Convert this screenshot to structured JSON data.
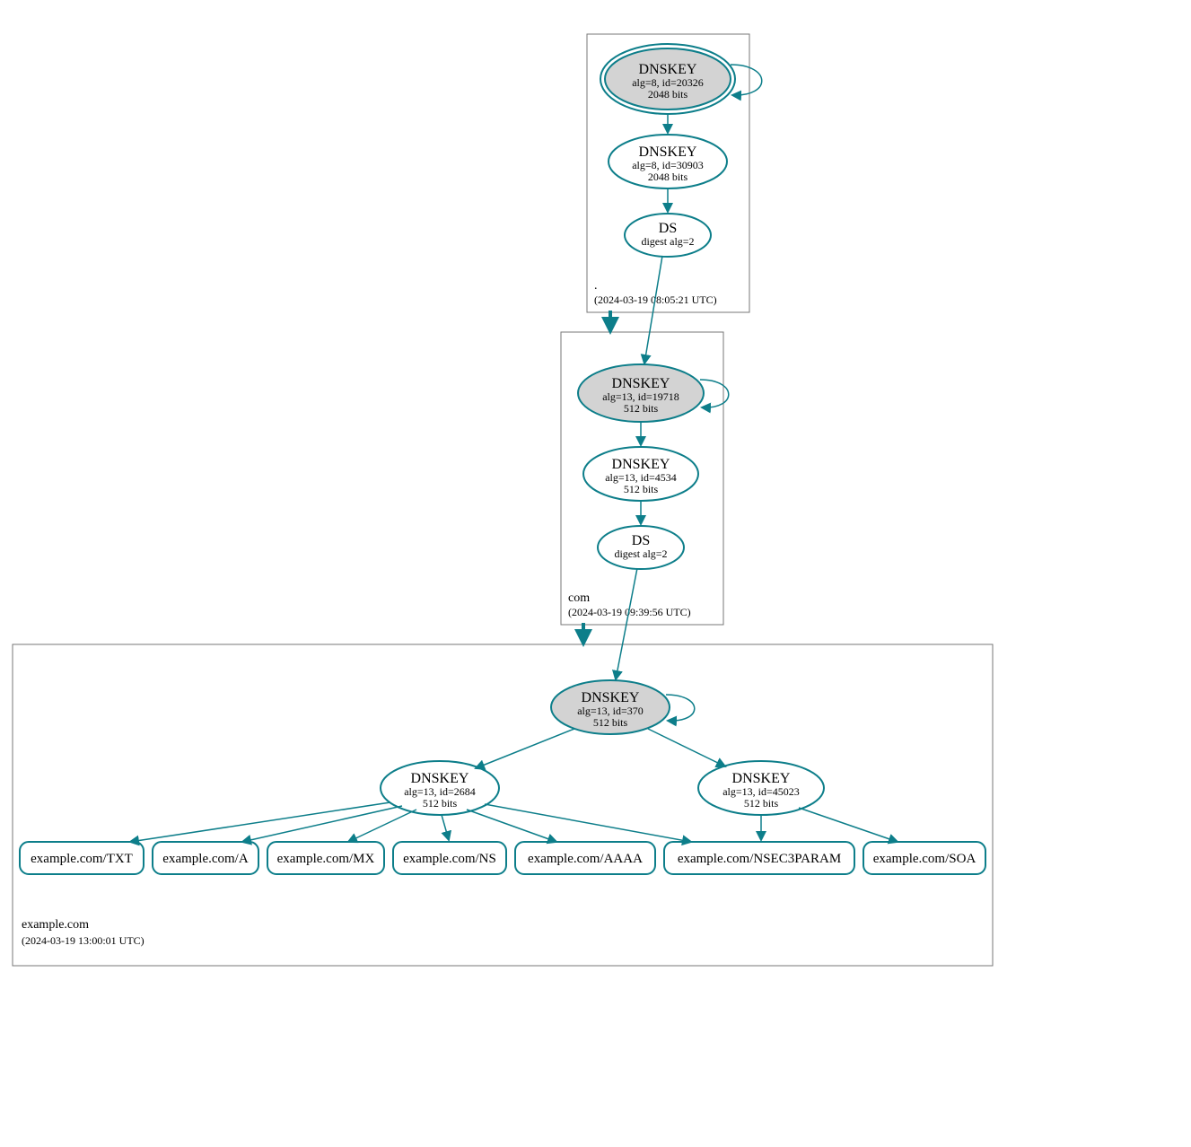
{
  "colors": {
    "teal": "#0d7e8a",
    "grey_fill": "#d3d3d3",
    "box_stroke": "#777777"
  },
  "zones": {
    "root": {
      "label": ".",
      "time": "(2024-03-19 08:05:21 UTC)"
    },
    "com": {
      "label": "com",
      "time": "(2024-03-19 09:39:56 UTC)"
    },
    "example": {
      "label": "example.com",
      "time": "(2024-03-19 13:00:01 UTC)"
    }
  },
  "nodes": {
    "root_ksk": {
      "title": "DNSKEY",
      "line1": "alg=8, id=20326",
      "line2": "2048 bits"
    },
    "root_zsk": {
      "title": "DNSKEY",
      "line1": "alg=8, id=30903",
      "line2": "2048 bits"
    },
    "root_ds": {
      "title": "DS",
      "line1": "digest alg=2"
    },
    "com_ksk": {
      "title": "DNSKEY",
      "line1": "alg=13, id=19718",
      "line2": "512 bits"
    },
    "com_zsk": {
      "title": "DNSKEY",
      "line1": "alg=13, id=4534",
      "line2": "512 bits"
    },
    "com_ds": {
      "title": "DS",
      "line1": "digest alg=2"
    },
    "ex_ksk": {
      "title": "DNSKEY",
      "line1": "alg=13, id=370",
      "line2": "512 bits"
    },
    "ex_zsk1": {
      "title": "DNSKEY",
      "line1": "alg=13, id=2684",
      "line2": "512 bits"
    },
    "ex_zsk2": {
      "title": "DNSKEY",
      "line1": "alg=13, id=45023",
      "line2": "512 bits"
    }
  },
  "rr": {
    "txt": "example.com/TXT",
    "a": "example.com/A",
    "mx": "example.com/MX",
    "ns": "example.com/NS",
    "aaaa": "example.com/AAAA",
    "nsec3": "example.com/NSEC3PARAM",
    "soa": "example.com/SOA"
  }
}
